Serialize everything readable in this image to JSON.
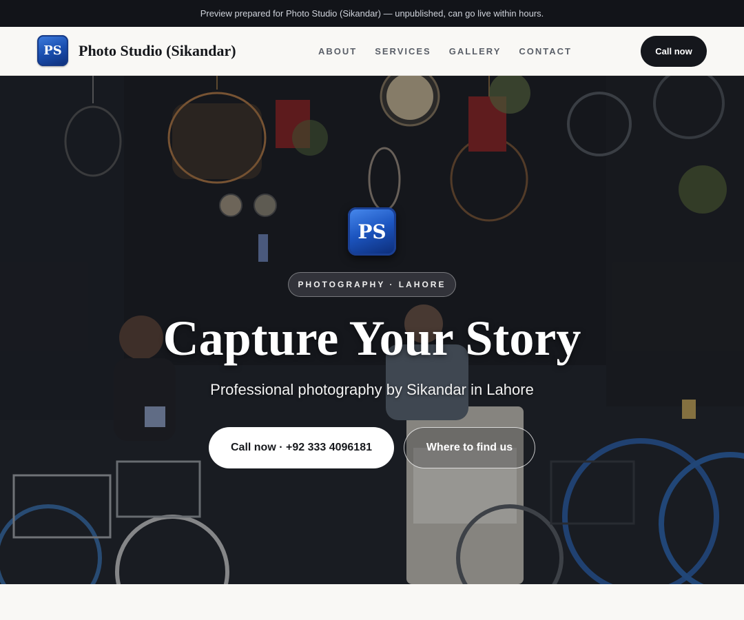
{
  "banner": {
    "text": "Preview prepared for Photo Studio (Sikandar) — unpublished, can go live within hours."
  },
  "header": {
    "logo_text": "PS",
    "brand_name": "Photo Studio (Sikandar)",
    "nav": [
      "ABOUT",
      "SERVICES",
      "GALLERY",
      "CONTACT"
    ],
    "call_button": "Call now"
  },
  "hero": {
    "logo_text": "PS",
    "tag": "PHOTOGRAPHY · LAHORE",
    "headline": "Capture Your Story",
    "subline": "Professional photography by Sikandar in Lahore",
    "cta_primary": "Call now · +92 333 4096181",
    "cta_secondary": "Where to find us"
  },
  "colors": {
    "banner_bg": "#121419",
    "header_bg": "#f9f8f5",
    "brand_dark": "#15171c",
    "logo_blue": "#1c55c0"
  }
}
